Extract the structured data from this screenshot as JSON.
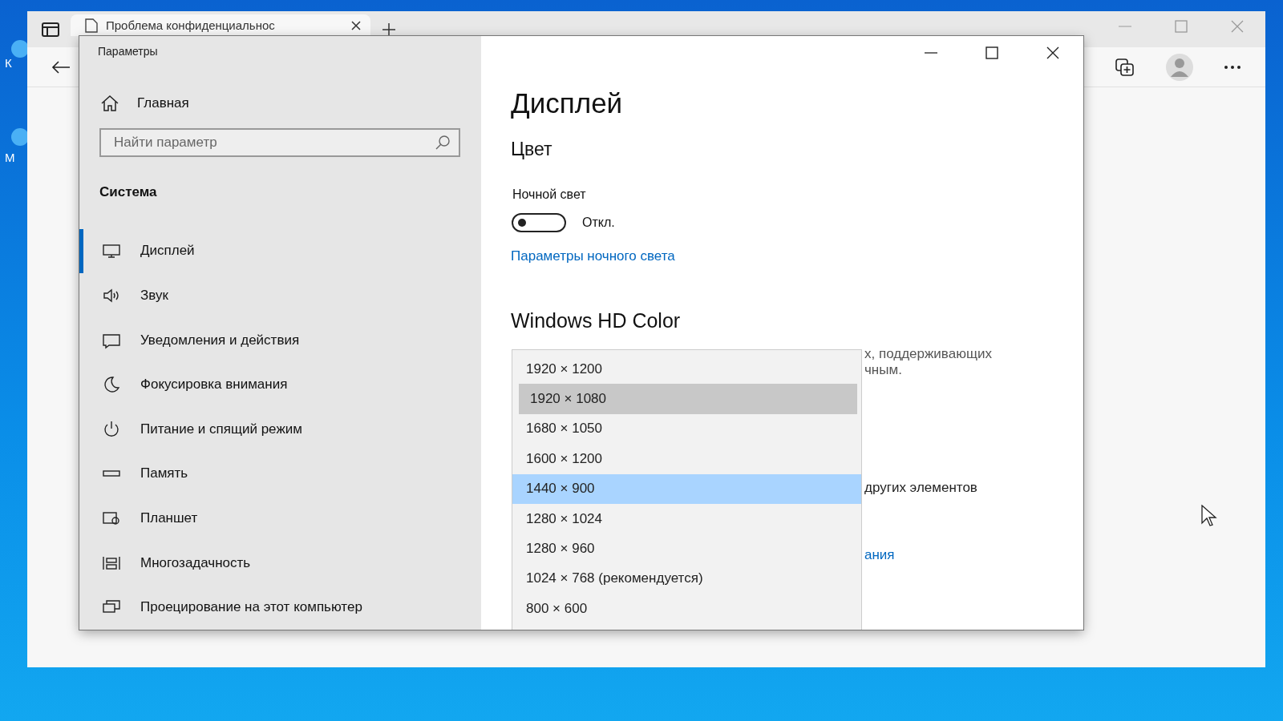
{
  "desktop": {
    "icon_labels": [
      "К",
      "М"
    ]
  },
  "browser": {
    "tab": {
      "title": "Проблема конфиденциальнос"
    }
  },
  "settings": {
    "window": {
      "title": "Параметры"
    },
    "sidebar": {
      "home": "Главная",
      "search": {
        "placeholder": "Найти параметр"
      },
      "section": "Система",
      "items": [
        {
          "label": "Дисплей",
          "selected": true
        },
        {
          "label": "Звук",
          "selected": false
        },
        {
          "label": "Уведомления и действия",
          "selected": false
        },
        {
          "label": "Фокусировка внимания",
          "selected": false
        },
        {
          "label": "Питание и спящий режим",
          "selected": false
        },
        {
          "label": "Память",
          "selected": false
        },
        {
          "label": "Планшет",
          "selected": false
        },
        {
          "label": "Многозадачность",
          "selected": false
        },
        {
          "label": "Проецирование на этот компьютер",
          "selected": false
        }
      ]
    },
    "content": {
      "title": "Дисплей",
      "section": "Цвет",
      "night_light": {
        "label": "Ночной свет",
        "on": false,
        "state": "Откл."
      },
      "night_link": "Параметры ночного света",
      "hd_title": "Windows HD Color",
      "hidden_fragments": [
        {
          "kind": "text",
          "text": "х, поддерживающих"
        },
        {
          "kind": "text",
          "text": "чным."
        },
        {
          "kind": "text",
          "text": "других элементов"
        },
        {
          "kind": "link",
          "text": "ания"
        }
      ]
    },
    "resolution_dropdown": {
      "options": [
        {
          "label": "1920 × 1200",
          "selected": false,
          "hovered": false
        },
        {
          "label": "1920 × 1080",
          "selected": false,
          "hovered": true
        },
        {
          "label": "1680 × 1050",
          "selected": false,
          "hovered": false
        },
        {
          "label": "1600 × 1200",
          "selected": false,
          "hovered": false
        },
        {
          "label": "1440 × 900",
          "selected": true,
          "hovered": false
        },
        {
          "label": "1280 × 1024",
          "selected": false,
          "hovered": false
        },
        {
          "label": "1280 × 960",
          "selected": false,
          "hovered": false
        },
        {
          "label": "1024 × 768 (рекомендуется)",
          "selected": false,
          "hovered": false
        },
        {
          "label": "800 × 600",
          "selected": false,
          "hovered": false
        }
      ]
    }
  }
}
